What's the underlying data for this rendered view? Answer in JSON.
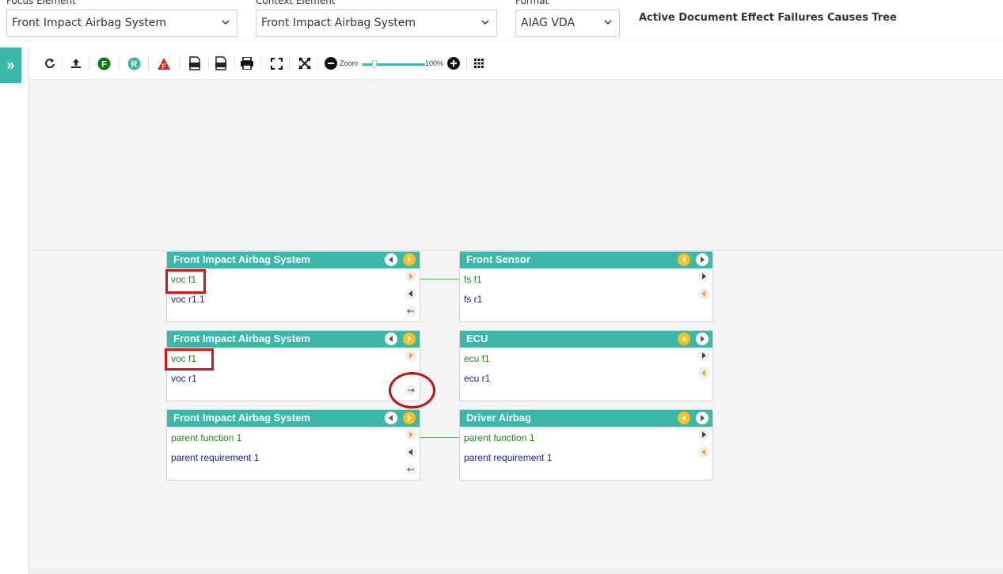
{
  "header": {
    "focus_label": "Focus Element",
    "focus_value": "Front Impact Airbag System",
    "context_label": "Context Element",
    "context_value": "Front Impact Airbag System",
    "format_label": "Format",
    "format_value": "AIAG VDA",
    "active_doc_label": "Active Document",
    "active_doc_value": ": Effect Failures Causes Tree"
  },
  "sidebar": {
    "toggle_glyph": "»"
  },
  "toolbar": {
    "zoom_label": "Zoom",
    "zoom_value": "100%",
    "icons": [
      "refresh-icon",
      "upload-icon",
      "function-icon",
      "requirement-icon",
      "failure-icon",
      "svg-export-icon",
      "png-export-icon",
      "print-icon",
      "fit-screen-icon",
      "expand-icon",
      "zoom-out-icon",
      "zoom-in-icon",
      "grid-icon"
    ],
    "function_letter": "F",
    "requirement_letter": "R",
    "failure_letter": "F"
  },
  "colors": {
    "accent": "#3db8a8",
    "function_text": "#1a8a1a",
    "requirement_text": "#1a1aa8",
    "highlight": "#d01818"
  },
  "nodes": {
    "left1": {
      "title": "Front Impact Airbag System",
      "row1": "voc f1",
      "row2": "voc r1.1"
    },
    "right1": {
      "title": "Front  Sensor",
      "row1": "fs f1",
      "row2": "fs r1"
    },
    "left2": {
      "title": "Front Impact Airbag System",
      "row1": "voc f1",
      "row2": "voc r1"
    },
    "right2": {
      "title": "ECU",
      "row1": "ecu f1",
      "row2": "ecu r1"
    },
    "left3": {
      "title": "Front Impact Airbag System",
      "row1": "parent function 1",
      "row2": "parent requirement 1"
    },
    "right3": {
      "title": "Driver Airbag",
      "row1": "parent function 1",
      "row2": "parent requirement 1"
    }
  }
}
